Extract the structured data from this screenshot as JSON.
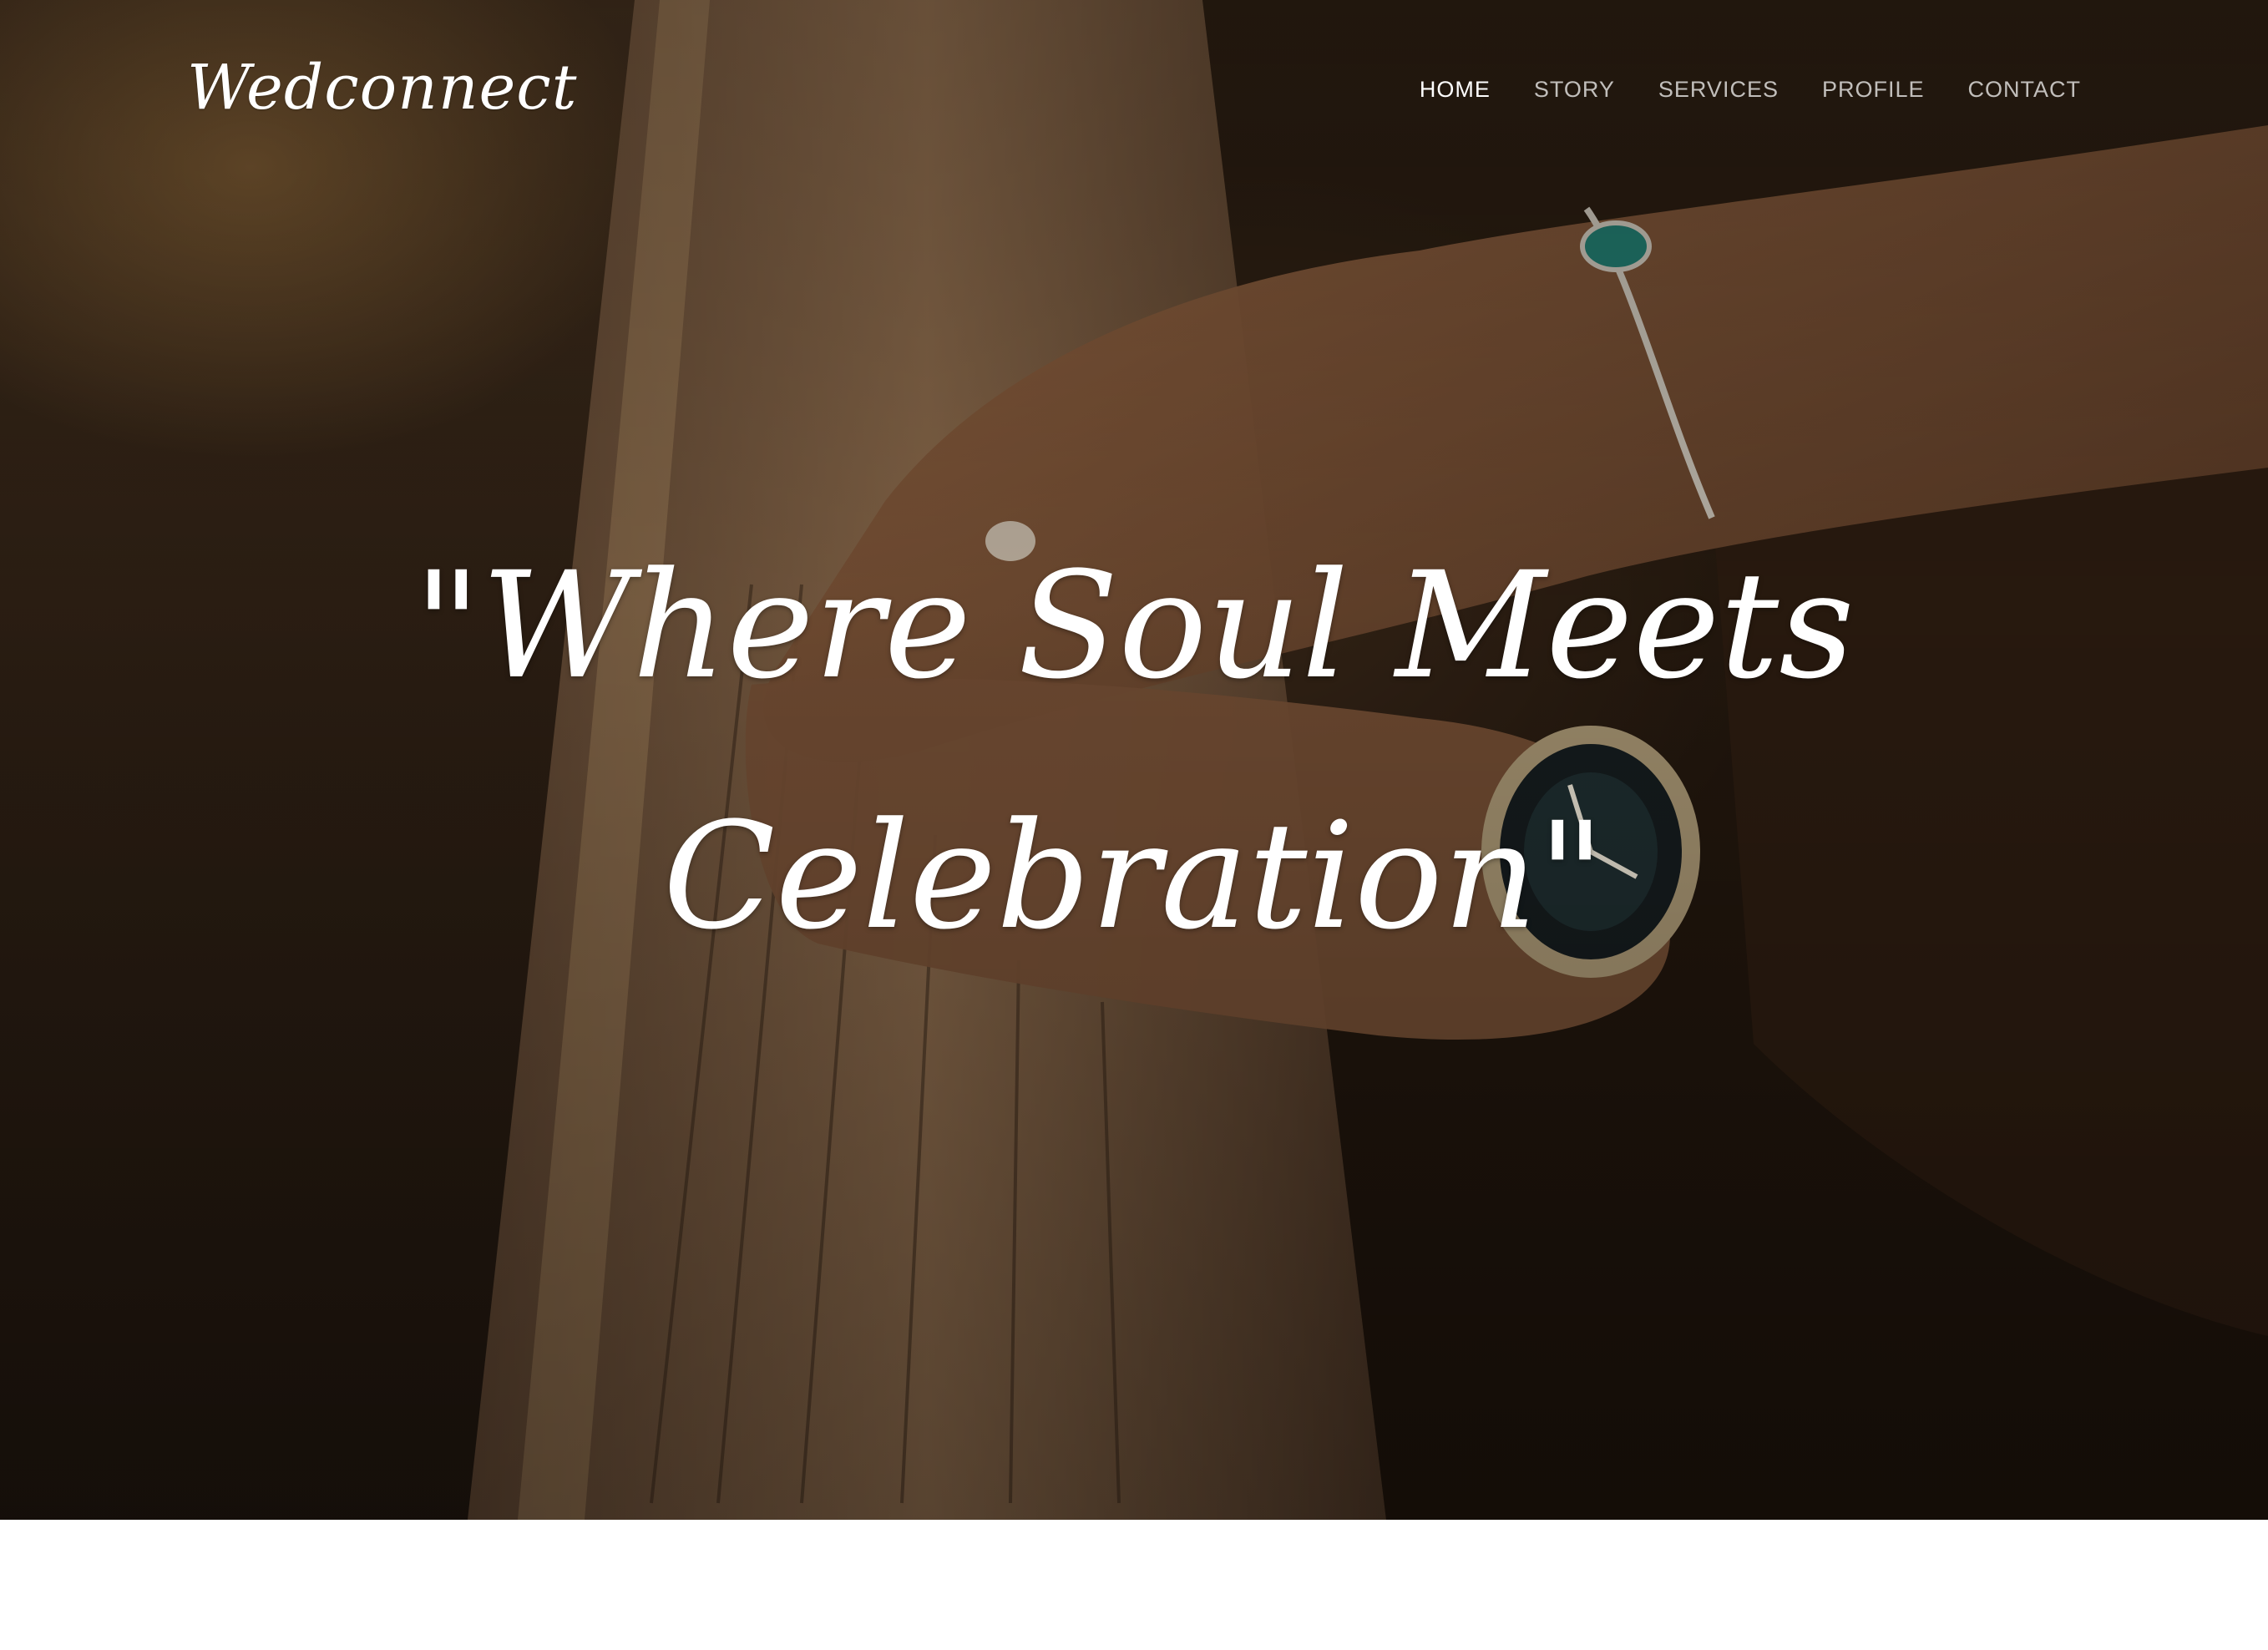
{
  "brand": {
    "logo_text": "Wedconnect"
  },
  "nav": {
    "items": [
      {
        "label": "HOME",
        "active": true
      },
      {
        "label": "STORY",
        "active": false
      },
      {
        "label": "SERVICES",
        "active": false
      },
      {
        "label": "PROFILE",
        "active": false
      },
      {
        "label": "CONTACT",
        "active": false
      }
    ]
  },
  "hero": {
    "line1": "\"Where Soul Meets",
    "line2": "Celebration\"",
    "image_subject": "hands-on-wooden-railing-photo"
  },
  "colors": {
    "text": "#ffffff",
    "hero_dark": "#1d140d",
    "hero_warm": "#7a5535",
    "page_background": "#ffffff"
  }
}
